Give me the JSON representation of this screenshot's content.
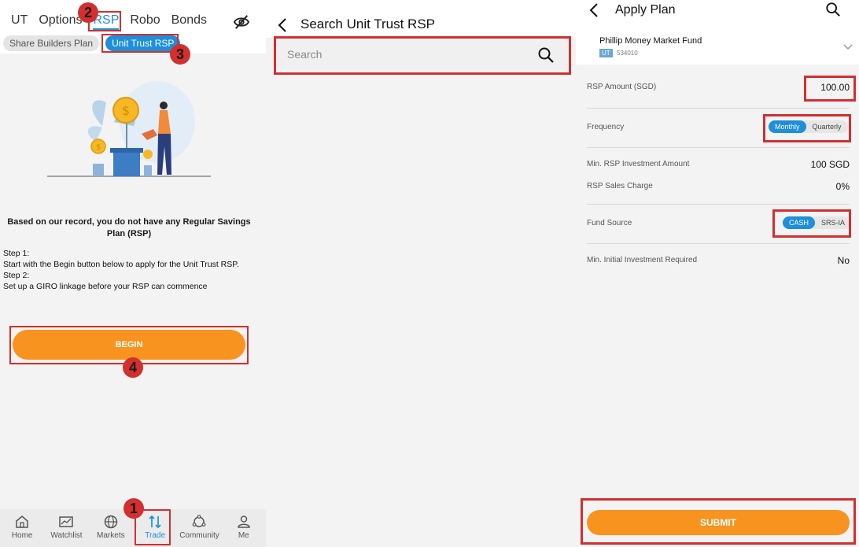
{
  "panel1": {
    "tabs": [
      "UT",
      "Options",
      "RSP",
      "Robo",
      "Bonds"
    ],
    "active_tab": "RSP",
    "chips": [
      "Share Builders Plan",
      "Unit Trust RSP"
    ],
    "heading": "Based on our record, you do not have any Regular Savings Plan (RSP)",
    "step1_label": "Step 1:",
    "step1_text": "Start with the Begin button below to apply for the Unit Trust RSP.",
    "step2_label": "Step 2:",
    "step2_text": "Set up a GIRO linkage before your RSP can commence",
    "begin_label": "BEGIN",
    "nav": [
      {
        "label": "Home",
        "icon": "home-icon"
      },
      {
        "label": "Watchlist",
        "icon": "chart-icon"
      },
      {
        "label": "Markets",
        "icon": "globe-icon"
      },
      {
        "label": "Trade",
        "icon": "trade-arrows-icon"
      },
      {
        "label": "Community",
        "icon": "community-icon"
      },
      {
        "label": "Me",
        "icon": "person-icon"
      }
    ],
    "step_numbers": [
      "1",
      "2",
      "3",
      "4"
    ]
  },
  "panel2": {
    "title": "Search Unit Trust RSP",
    "search_placeholder": "Search"
  },
  "panel3": {
    "title": "Apply Plan",
    "fund_name": "Phillip Money Market Fund",
    "fund_tag": "UT",
    "fund_code": "534010",
    "rsp_amount_label": "RSP Amount (SGD)",
    "rsp_amount_value": "100.00",
    "frequency_label": "Frequency",
    "frequency_options": [
      "Monthly",
      "Quarterly"
    ],
    "frequency_selected": "Monthly",
    "min_rsp_label": "Min. RSP Investment Amount",
    "min_rsp_value": "100 SGD",
    "sales_charge_label": "RSP Sales Charge",
    "sales_charge_value": "0%",
    "fund_source_label": "Fund Source",
    "fund_source_options": [
      "CASH",
      "SRS-IA"
    ],
    "fund_source_selected": "CASH",
    "min_initial_label": "Min. Initial Investment Required",
    "min_initial_value": "No",
    "submit_label": "SUBMIT"
  },
  "colors": {
    "accent_blue": "#1e8fd8",
    "orange": "#f7931e",
    "annotation_red": "#d32f2f"
  }
}
